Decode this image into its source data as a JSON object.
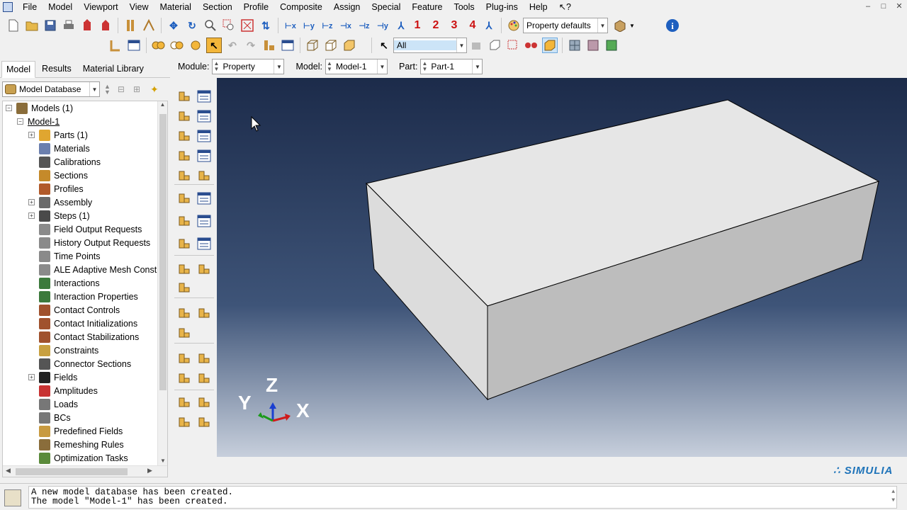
{
  "menubar": {
    "items": [
      "File",
      "Model",
      "Viewport",
      "View",
      "Material",
      "Section",
      "Profile",
      "Composite",
      "Assign",
      "Special",
      "Feature",
      "Tools",
      "Plug-ins",
      "Help",
      "↖?"
    ],
    "window_controls": [
      "–",
      "□",
      "✕"
    ]
  },
  "toolbar1": {
    "view_numbers": [
      "1",
      "2",
      "3",
      "4"
    ],
    "property_combo": "Property defaults"
  },
  "toolbar2": {
    "selection_filter": "All"
  },
  "context": {
    "module_label": "Module:",
    "module_value": "Property",
    "model_label": "Model:",
    "model_value": "Model-1",
    "part_label": "Part:",
    "part_value": "Part-1"
  },
  "left_tabs": [
    "Model",
    "Results",
    "Material Library"
  ],
  "db_combo": "Model Database",
  "tree": [
    {
      "label": "Models (1)",
      "exp": "-",
      "indent": 0,
      "color": "#8a6d3b"
    },
    {
      "label": "Model-1",
      "exp": "-",
      "indent": 1,
      "color": "",
      "underline": true
    },
    {
      "label": "Parts (1)",
      "exp": "+",
      "indent": 2,
      "color": "#e0a630"
    },
    {
      "label": "Materials",
      "exp": "",
      "indent": 2,
      "color": "#6b7fae"
    },
    {
      "label": "Calibrations",
      "exp": "",
      "indent": 2,
      "color": "#555"
    },
    {
      "label": "Sections",
      "exp": "",
      "indent": 2,
      "color": "#c58a2a"
    },
    {
      "label": "Profiles",
      "exp": "",
      "indent": 2,
      "color": "#b15a2a"
    },
    {
      "label": "Assembly",
      "exp": "+",
      "indent": 2,
      "color": "#6a6a6a"
    },
    {
      "label": "Steps (1)",
      "exp": "+",
      "indent": 2,
      "color": "#4a4a4a"
    },
    {
      "label": "Field Output Requests",
      "exp": "",
      "indent": 2,
      "color": "#8a8a8a"
    },
    {
      "label": "History Output Requests",
      "exp": "",
      "indent": 2,
      "color": "#8a8a8a"
    },
    {
      "label": "Time Points",
      "exp": "",
      "indent": 2,
      "color": "#8a8a8a"
    },
    {
      "label": "ALE Adaptive Mesh Constra",
      "exp": "",
      "indent": 2,
      "color": "#8a8a8a"
    },
    {
      "label": "Interactions",
      "exp": "",
      "indent": 2,
      "color": "#3c7a3c"
    },
    {
      "label": "Interaction Properties",
      "exp": "",
      "indent": 2,
      "color": "#3c7a3c"
    },
    {
      "label": "Contact Controls",
      "exp": "",
      "indent": 2,
      "color": "#a0522d"
    },
    {
      "label": "Contact Initializations",
      "exp": "",
      "indent": 2,
      "color": "#a0522d"
    },
    {
      "label": "Contact Stabilizations",
      "exp": "",
      "indent": 2,
      "color": "#a0522d"
    },
    {
      "label": "Constraints",
      "exp": "",
      "indent": 2,
      "color": "#c8a040"
    },
    {
      "label": "Connector Sections",
      "exp": "",
      "indent": 2,
      "color": "#555"
    },
    {
      "label": "Fields",
      "exp": "+",
      "indent": 2,
      "color": "#222"
    },
    {
      "label": "Amplitudes",
      "exp": "",
      "indent": 2,
      "color": "#c83232"
    },
    {
      "label": "Loads",
      "exp": "",
      "indent": 2,
      "color": "#777"
    },
    {
      "label": "BCs",
      "exp": "",
      "indent": 2,
      "color": "#777"
    },
    {
      "label": "Predefined Fields",
      "exp": "",
      "indent": 2,
      "color": "#c89a40"
    },
    {
      "label": "Remeshing Rules",
      "exp": "",
      "indent": 2,
      "color": "#8a6d3b"
    },
    {
      "label": "Optimization Tasks",
      "exp": "",
      "indent": 2,
      "color": "#5a8a3a"
    }
  ],
  "triad": {
    "x": "X",
    "y": "Y",
    "z": "Z"
  },
  "brand": "∴ SIMULIA",
  "messages": [
    "A new model database has been created.",
    "The model \"Model-1\" has been created."
  ],
  "colors": {
    "viewport_top": "#1c2b4a",
    "viewport_bottom": "#c7cfdc",
    "part_top": "#e8e8e8",
    "part_front": "#bdbdbd",
    "part_left": "#dedede"
  }
}
